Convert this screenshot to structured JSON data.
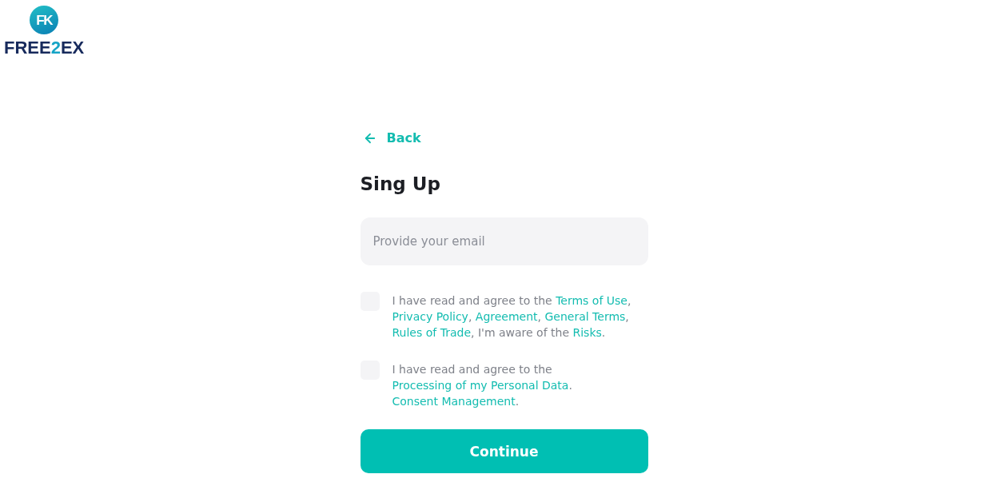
{
  "logo": {
    "mark": "FK",
    "wordmark": [
      {
        "text": "FREE",
        "kind": "plain"
      },
      {
        "text": "2",
        "kind": "accent"
      },
      {
        "text": "EX",
        "kind": "plain"
      }
    ]
  },
  "back_link": {
    "label": "Back"
  },
  "title": "Sing Up",
  "email_field": {
    "placeholder": "Provide your email"
  },
  "agreements": [
    {
      "checked": false,
      "label": [
        {
          "text": "I have read and agree to the ",
          "kind": "plain"
        },
        {
          "text": "Terms of Use",
          "kind": "link"
        },
        {
          "text": ", ",
          "kind": "plain"
        },
        {
          "text": "Privacy Policy",
          "kind": "link"
        },
        {
          "text": ", ",
          "kind": "plain"
        },
        {
          "text": "Agreement",
          "kind": "link"
        },
        {
          "text": ", ",
          "kind": "plain"
        },
        {
          "text": "General Terms",
          "kind": "link"
        },
        {
          "text": ", ",
          "kind": "plain"
        },
        {
          "text": "Rules of Trade",
          "kind": "link"
        },
        {
          "text": ", I'm aware of the ",
          "kind": "plain"
        },
        {
          "text": "Risks",
          "kind": "link"
        },
        {
          "text": ".",
          "kind": "plain"
        }
      ]
    },
    {
      "checked": false,
      "label": [
        {
          "text": "I have read and agree to the ",
          "kind": "plain"
        },
        {
          "text": "Processing of my Personal Data",
          "kind": "link"
        },
        {
          "text": ". ",
          "kind": "plain"
        },
        {
          "text": "Consent Management",
          "kind": "link"
        },
        {
          "text": ".",
          "kind": "plain"
        }
      ]
    }
  ],
  "continue_button": {
    "label": "Continue"
  }
}
